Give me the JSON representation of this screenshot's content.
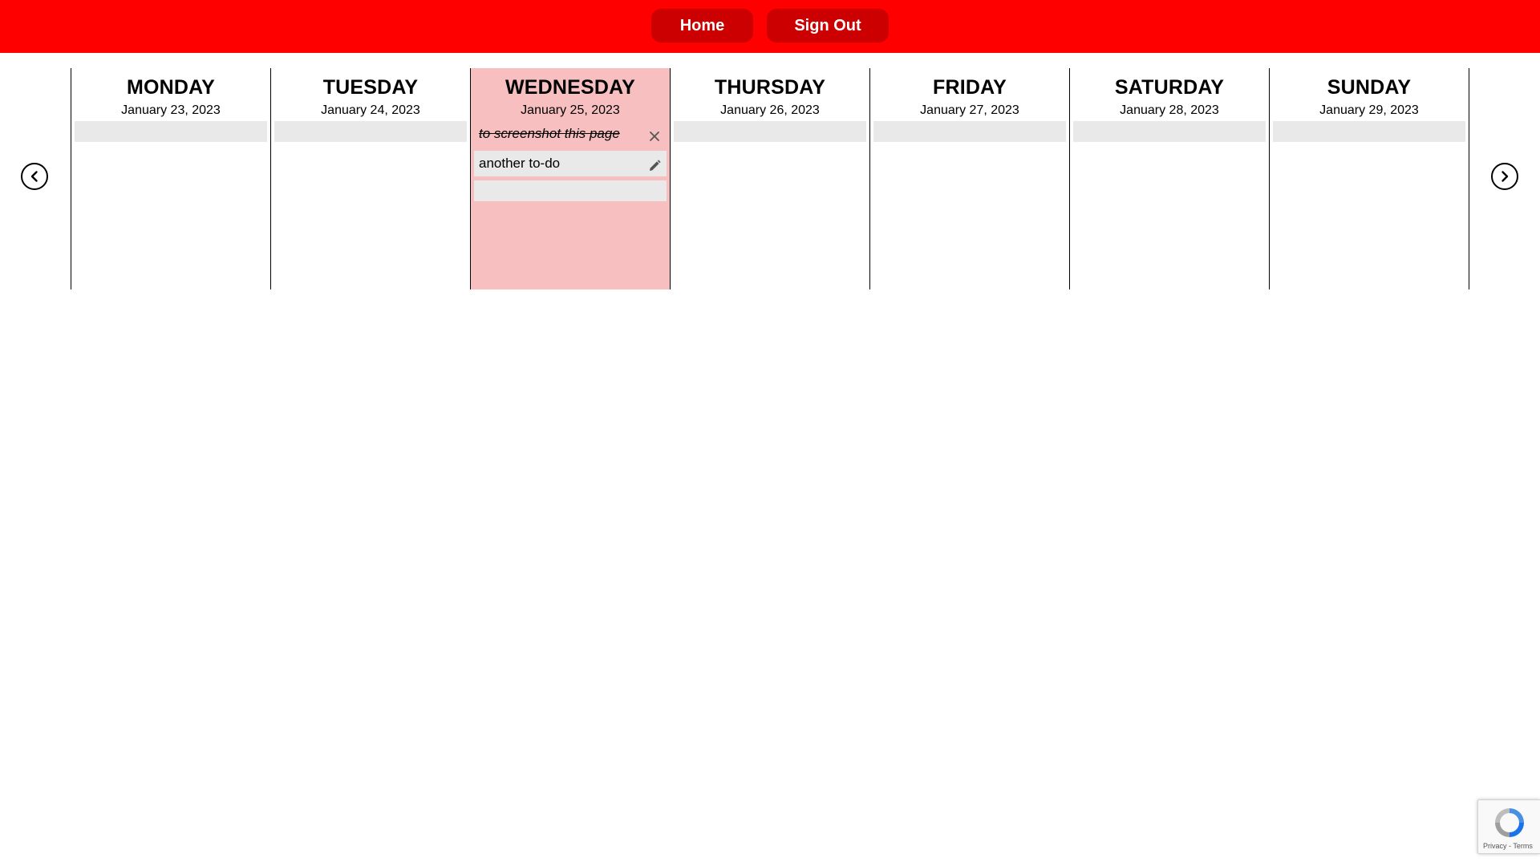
{
  "nav": {
    "home_label": "Home",
    "signout_label": "Sign Out"
  },
  "colors": {
    "topbar": "#ff0000",
    "nav_button": "#cc0000",
    "today_bg": "#f7bfc0",
    "todo_bg": "#e9e9e9"
  },
  "calendar": {
    "prev_icon": "chevron-left-icon",
    "next_icon": "chevron-right-icon",
    "days": [
      {
        "name": "MONDAY",
        "date": "January 23, 2023",
        "today": false,
        "todos": []
      },
      {
        "name": "TUESDAY",
        "date": "January 24, 2023",
        "today": false,
        "todos": []
      },
      {
        "name": "WEDNESDAY",
        "date": "January 25, 2023",
        "today": true,
        "todos": [
          {
            "text": "to screenshot this page",
            "done": true,
            "action_icon": "close-icon"
          },
          {
            "text": "another to-do",
            "done": false,
            "action_icon": "pencil-icon"
          }
        ]
      },
      {
        "name": "THURSDAY",
        "date": "January 26, 2023",
        "today": false,
        "todos": []
      },
      {
        "name": "FRIDAY",
        "date": "January 27, 2023",
        "today": false,
        "todos": []
      },
      {
        "name": "SATURDAY",
        "date": "January 28, 2023",
        "today": false,
        "todos": []
      },
      {
        "name": "SUNDAY",
        "date": "January 29, 2023",
        "today": false,
        "todos": []
      }
    ]
  },
  "recaptcha": {
    "footer": "Privacy - Terms",
    "icon": "recaptcha-icon"
  }
}
